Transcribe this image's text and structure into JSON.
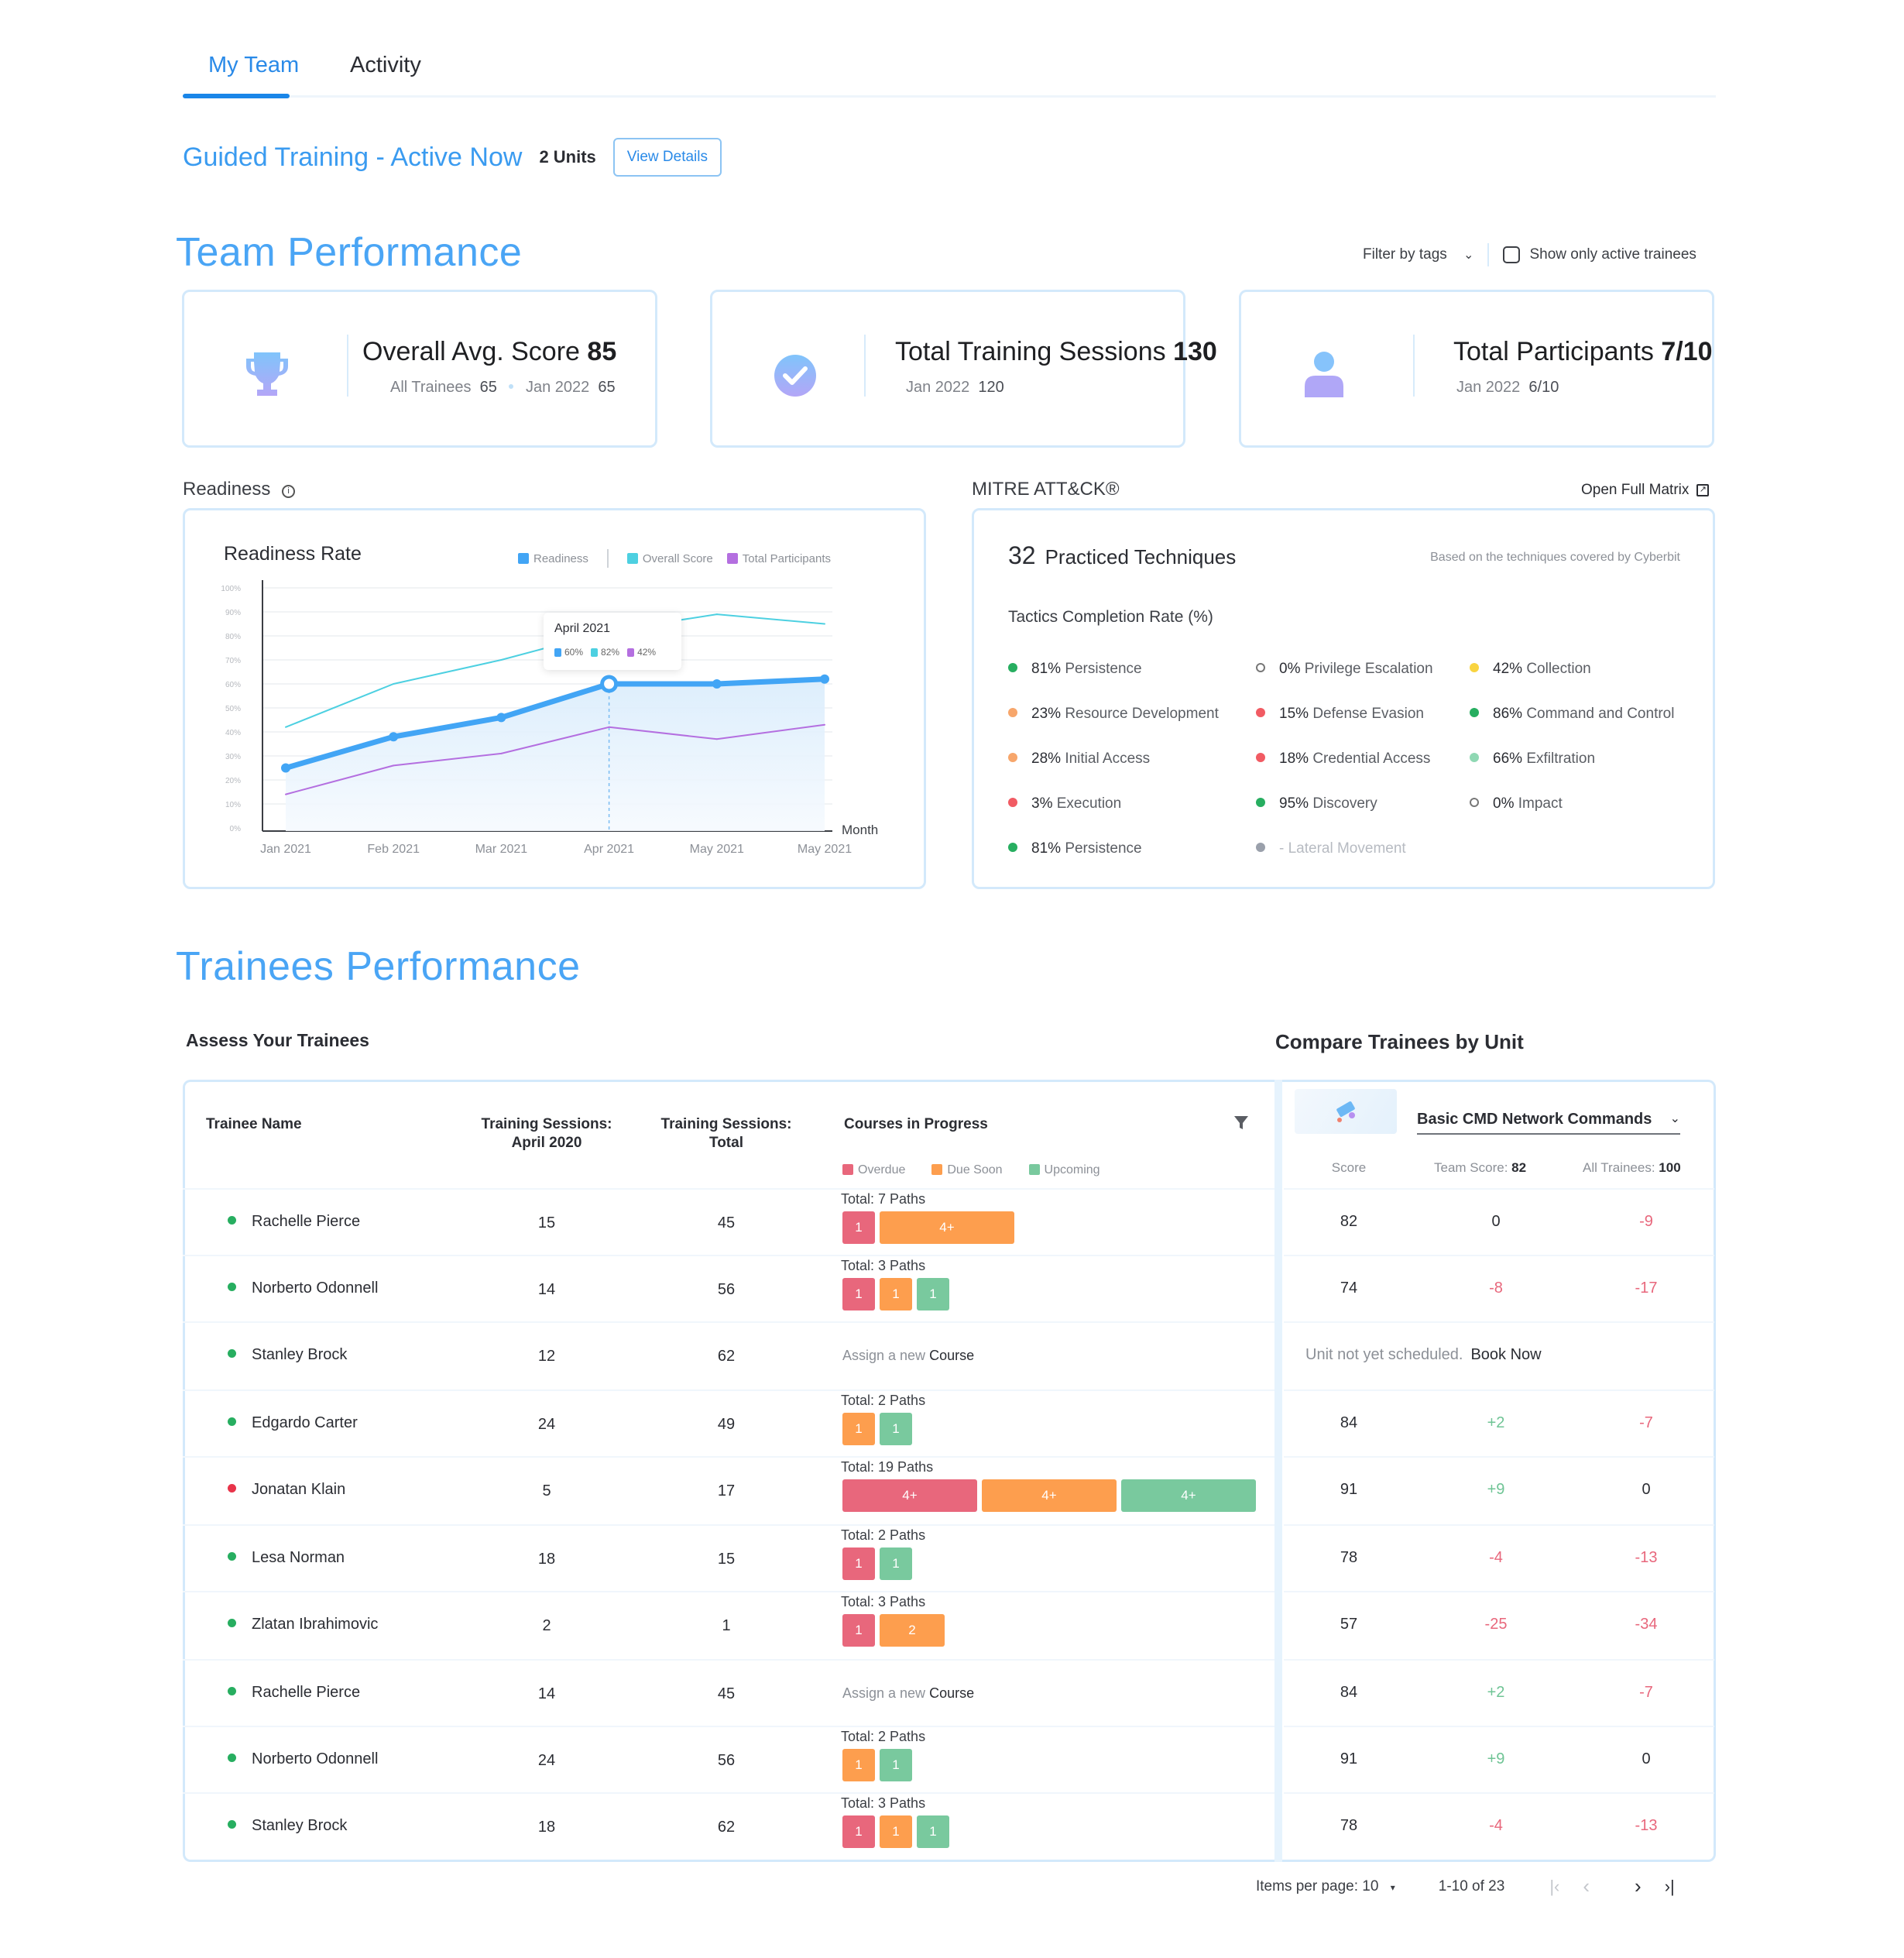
{
  "tabs": [
    {
      "label": "My Team",
      "active": true
    },
    {
      "label": "Activity",
      "active": false
    }
  ],
  "guided": {
    "title": "Guided Training - Active Now",
    "units": "2 Units",
    "view_details": "View Details"
  },
  "team_performance": {
    "title": "Team Performance",
    "filter_label": "Filter by tags",
    "show_active_label": "Show only active trainees",
    "show_active_checked": false,
    "kpis": [
      {
        "icon": "trophy-icon",
        "title": "Overall Avg. Score",
        "value": "85",
        "sub": [
          {
            "label": "All Trainees",
            "value": "65"
          },
          {
            "label": "Jan 2022",
            "value": "65"
          }
        ]
      },
      {
        "icon": "check-circle-icon",
        "title": "Total Training Sessions",
        "value": "130",
        "sub": [
          {
            "label": "Jan 2022",
            "value": "120"
          }
        ]
      },
      {
        "icon": "user-icon",
        "title": "Total Participants",
        "value": "7/10",
        "sub": [
          {
            "label": "Jan 2022",
            "value": "6/10"
          }
        ]
      }
    ]
  },
  "readiness": {
    "section_label": "Readiness",
    "card_title": "Readiness Rate",
    "tooltip": {
      "title": "April 2021",
      "values": [
        "60%",
        "82%",
        "42%"
      ]
    }
  },
  "chart_data": {
    "type": "line",
    "title": "Readiness Rate",
    "xlabel": "Month",
    "ylabel": "",
    "x": [
      "Jan 2021",
      "Feb 2021",
      "Mar 2021",
      "Apr 2021",
      "May 2021",
      "May 2021"
    ],
    "yticks": [
      "0%",
      "10%",
      "20%",
      "30%",
      "40%",
      "50%",
      "60%",
      "70%",
      "80%",
      "90%",
      "100%"
    ],
    "ylim": [
      0,
      100
    ],
    "grid": true,
    "legend": "top-right",
    "highlight_index": 3,
    "series": [
      {
        "name": "Readiness",
        "color": "#42a5f5",
        "values": [
          25,
          38,
          46,
          60,
          60,
          62
        ],
        "area": true,
        "markers": true
      },
      {
        "name": "Overall Score",
        "color": "#4dd0e1",
        "values": [
          42,
          60,
          70,
          82,
          89,
          85
        ]
      },
      {
        "name": "Total Participants",
        "color": "#b46fe0",
        "values": [
          14,
          26,
          31,
          42,
          37,
          43
        ]
      }
    ]
  },
  "mitre": {
    "title": "MITRE ATT&CK®",
    "open_matrix": "Open Full Matrix",
    "count": "32",
    "count_label": "Practiced Techniques",
    "note": "Based on the techniques covered by Cyberbit",
    "subtitle": "Tactics Completion Rate (%)",
    "tactics": [
      {
        "pct": "81%",
        "name": "Persistence",
        "color": "#27ae60"
      },
      {
        "pct": "23%",
        "name": "Resource Development",
        "color": "#f7a66b"
      },
      {
        "pct": "28%",
        "name": "Initial Access",
        "color": "#f7a66b"
      },
      {
        "pct": "3%",
        "name": "Execution",
        "color": "#f15b63"
      },
      {
        "pct": "81%",
        "name": "Persistence",
        "color": "#27ae60"
      },
      {
        "pct": "0%",
        "name": "Privilege Escalation",
        "color": "empty"
      },
      {
        "pct": "15%",
        "name": "Defense Evasion",
        "color": "#f15b63"
      },
      {
        "pct": "18%",
        "name": "Credential Access",
        "color": "#f15b63"
      },
      {
        "pct": "95%",
        "name": "Discovery",
        "color": "#27ae60"
      },
      {
        "pct": "-",
        "name": "Lateral Movement",
        "color": "#9aa0ab",
        "muted": true
      },
      {
        "pct": "42%",
        "name": "Collection",
        "color": "#f9d440"
      },
      {
        "pct": "86%",
        "name": "Command and Control",
        "color": "#27ae60"
      },
      {
        "pct": "66%",
        "name": "Exfiltration",
        "color": "#8fd8b3"
      },
      {
        "pct": "0%",
        "name": "Impact",
        "color": "empty"
      }
    ]
  },
  "trainees": {
    "title": "Trainees Performance",
    "assess_title": "Assess Your Trainees",
    "compare_title": "Compare Trainees by Unit",
    "columns": {
      "name": "Trainee Name",
      "sessions_month_1": "Training Sessions:",
      "sessions_month_2": "April 2020",
      "sessions_total_1": "Training Sessions:",
      "sessions_total_2": "Total",
      "courses": "Courses in Progress"
    },
    "course_legend": [
      {
        "label": "Overdue",
        "color": "#e8677c"
      },
      {
        "label": "Due Soon",
        "color": "#fd9e4e"
      },
      {
        "label": "Upcoming",
        "color": "#79c99e"
      }
    ],
    "unit_select": "Basic CMD Network Commands",
    "compare_columns": {
      "score": "Score",
      "team_label": "Team Score:",
      "team_value": "82",
      "all_label": "All Trainees:",
      "all_value": "100"
    },
    "assign_text": "Assign a new",
    "assign_link": "Course",
    "unscheduled_text": "Unit not yet scheduled.",
    "book_now": "Book Now",
    "rows": [
      {
        "name": "Rachelle Pierce",
        "status": "active",
        "month": "15",
        "total": "45",
        "paths": "Total: 7 Paths",
        "chips": [
          {
            "type": "overdue",
            "label": "1",
            "w": 1
          },
          {
            "type": "due",
            "label": "4+",
            "w": 4
          }
        ],
        "score": "82",
        "team": "0",
        "all": "-9"
      },
      {
        "name": "Norberto Odonnell",
        "status": "active",
        "month": "14",
        "total": "56",
        "paths": "Total: 3 Paths",
        "chips": [
          {
            "type": "overdue",
            "label": "1",
            "w": 1
          },
          {
            "type": "due",
            "label": "1",
            "w": 1
          },
          {
            "type": "upcoming",
            "label": "1",
            "w": 1
          }
        ],
        "score": "74",
        "team": "-8",
        "all": "-17"
      },
      {
        "name": "Stanley Brock",
        "status": "active",
        "month": "12",
        "total": "62",
        "paths": null,
        "chips": [],
        "score": null,
        "team": null,
        "all": null,
        "unscheduled": true
      },
      {
        "name": "Edgardo Carter",
        "status": "active",
        "month": "24",
        "total": "49",
        "paths": "Total: 2 Paths",
        "chips": [
          {
            "type": "due",
            "label": "1",
            "w": 1
          },
          {
            "type": "upcoming",
            "label": "1",
            "w": 1
          }
        ],
        "score": "84",
        "team": "+2",
        "all": "-7"
      },
      {
        "name": "Jonatan Klain",
        "status": "inactive",
        "month": "5",
        "total": "17",
        "paths": "Total: 19 Paths",
        "chips": [
          {
            "type": "overdue",
            "label": "4+",
            "w": 4
          },
          {
            "type": "due",
            "label": "4+",
            "w": 4
          },
          {
            "type": "upcoming",
            "label": "4+",
            "w": 4
          }
        ],
        "score": "91",
        "team": "+9",
        "all": "0"
      },
      {
        "name": "Lesa Norman",
        "status": "active",
        "month": "18",
        "total": "15",
        "paths": "Total: 2 Paths",
        "chips": [
          {
            "type": "overdue",
            "label": "1",
            "w": 1
          },
          {
            "type": "upcoming",
            "label": "1",
            "w": 1
          }
        ],
        "score": "78",
        "team": "-4",
        "all": "-13"
      },
      {
        "name": "Zlatan Ibrahimovic",
        "status": "active",
        "month": "2",
        "total": "1",
        "paths": "Total: 3 Paths",
        "chips": [
          {
            "type": "overdue",
            "label": "1",
            "w": 1
          },
          {
            "type": "due",
            "label": "2",
            "w": 2
          }
        ],
        "score": "57",
        "team": "-25",
        "all": "-34"
      },
      {
        "name": "Rachelle Pierce",
        "status": "active",
        "month": "14",
        "total": "45",
        "paths": null,
        "chips": [],
        "score": "84",
        "team": "+2",
        "all": "-7"
      },
      {
        "name": "Norberto Odonnell",
        "status": "active",
        "month": "24",
        "total": "56",
        "paths": "Total: 2 Paths",
        "chips": [
          {
            "type": "due",
            "label": "1",
            "w": 1
          },
          {
            "type": "upcoming",
            "label": "1",
            "w": 1
          }
        ],
        "score": "91",
        "team": "+9",
        "all": "0"
      },
      {
        "name": "Stanley Brock",
        "status": "active",
        "month": "18",
        "total": "62",
        "paths": "Total: 3 Paths",
        "chips": [
          {
            "type": "overdue",
            "label": "1",
            "w": 1
          },
          {
            "type": "due",
            "label": "1",
            "w": 1
          },
          {
            "type": "upcoming",
            "label": "1",
            "w": 1
          }
        ],
        "score": "78",
        "team": "-4",
        "all": "-13"
      }
    ]
  },
  "pagination": {
    "items_per_page_label": "Items per page: 10",
    "range": "1-10 of 23"
  },
  "colors": {
    "accent": "#2a8ae8",
    "overdue": "#e8677c",
    "due": "#fd9e4e",
    "upcoming": "#79c99e",
    "positive": "#6fc495",
    "negative": "#e8677c",
    "active_dot": "#27ae60",
    "inactive_dot": "#e8344a"
  }
}
